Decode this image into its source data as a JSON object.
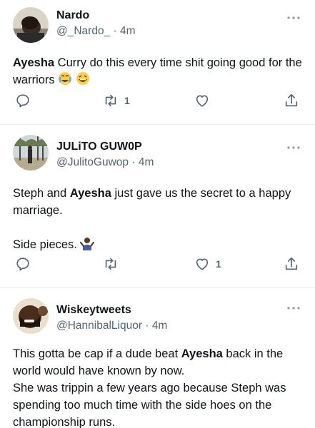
{
  "tweets": [
    {
      "name": "Nardo",
      "handle": "@_Nardo_",
      "time": "4m",
      "text_parts": [
        "Ayesha",
        " Curry do this every time shit going good for the warriors "
      ],
      "reply_count": "",
      "retweet_count": "1",
      "like_count": "",
      "emojis": [
        "crying-face-emoji",
        "laughing-face-emoji"
      ]
    },
    {
      "name": "JULiTO GUW0P",
      "handle": "@JulitoGuwop",
      "time": "4m",
      "line1_a": "Steph and ",
      "line1_bold": "Ayesha",
      "line1_b": " just gave us the secret to a happy",
      "line2": "marriage.",
      "line3": "Side pieces. ",
      "retweet_count": "",
      "like_count": "1",
      "emojis": [
        "shrug-emoji"
      ]
    },
    {
      "name": "Wiskeytweets",
      "handle": "@HannibalLiquor",
      "time": "4m",
      "line1_a": "This gotta be cap if a dude beat ",
      "line1_bold": "Ayesha",
      "line1_b": " back in the",
      "line2": "world would have known by now.",
      "line3": "She was trippin a few years ago because Steph was",
      "line4": "spending too much time with the side hoes on the",
      "line5": "championship runs."
    }
  ],
  "separator": "·",
  "colors": {
    "text": "#0f1419",
    "muted": "#536471",
    "border": "#e6ecf0"
  },
  "icons": [
    "reply-icon",
    "retweet-icon",
    "like-icon",
    "share-icon",
    "more-icon"
  ]
}
